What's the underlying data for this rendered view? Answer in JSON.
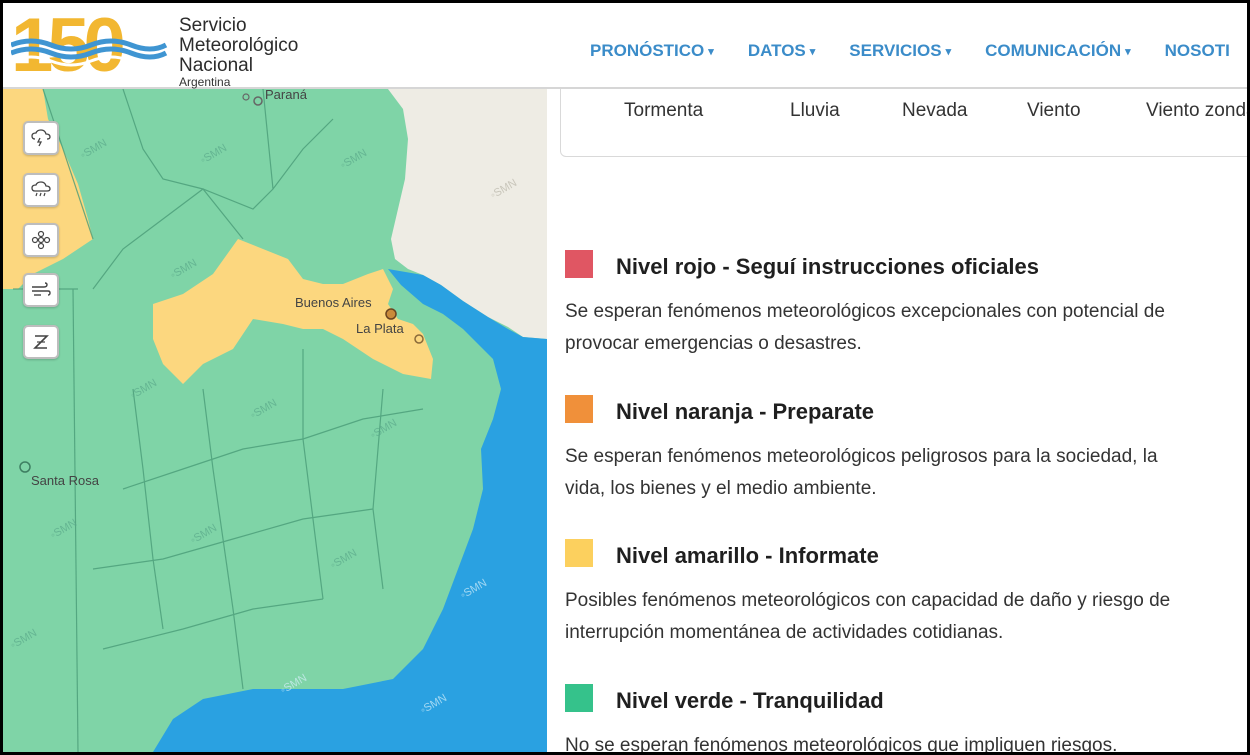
{
  "header": {
    "logo_number": "150",
    "logo_line1": "Servicio",
    "logo_line2": "Meteorológico",
    "logo_line3": "Nacional",
    "logo_line4": "Argentina",
    "nav": [
      {
        "label": "PRONÓSTICO"
      },
      {
        "label": "DATOS"
      },
      {
        "label": "SERVICIOS"
      },
      {
        "label": "COMUNICACIÓN"
      },
      {
        "label": "NOSOTI"
      }
    ]
  },
  "map": {
    "cities": {
      "parana": "Paraná",
      "buenos_aires": "Buenos Aires",
      "la_plata": "La Plata",
      "santa_rosa": "Santa Rosa"
    },
    "watermark": "SMN",
    "buttons": [
      "storm-icon",
      "rain-icon",
      "snow-icon",
      "wind-icon",
      "zonda-icon"
    ],
    "colors": {
      "green": "#7fd4a7",
      "yellow": "#fcd77f",
      "sea": "#2aa1e1",
      "neighbor": "#eeece4"
    }
  },
  "tabs": [
    {
      "label": "Tormenta"
    },
    {
      "label": "Lluvia"
    },
    {
      "label": "Nevada"
    },
    {
      "label": "Viento"
    },
    {
      "label": "Viento zonda"
    }
  ],
  "levels": [
    {
      "color": "#e05663",
      "title": "Nivel rojo - Seguí instrucciones oficiales",
      "desc1": "Se esperan fenómenos meteorológicos excepcionales con potencial de",
      "desc2": "provocar emergencias o desastres."
    },
    {
      "color": "#f0903a",
      "title": "Nivel naranja - Preparate",
      "desc1": "Se esperan fenómenos meteorológicos peligrosos para la sociedad, la",
      "desc2": "vida, los bienes y el medio ambiente."
    },
    {
      "color": "#fcd05e",
      "title": "Nivel amarillo - Informate",
      "desc1": "Posibles fenómenos meteorológicos con capacidad de daño y riesgo de",
      "desc2": "interrupción momentánea de actividades cotidianas."
    },
    {
      "color": "#35c28b",
      "title": "Nivel verde - Tranquilidad",
      "desc1": "No se esperan fenómenos meteorológicos que impliquen riesgos.",
      "desc2": ""
    }
  ]
}
